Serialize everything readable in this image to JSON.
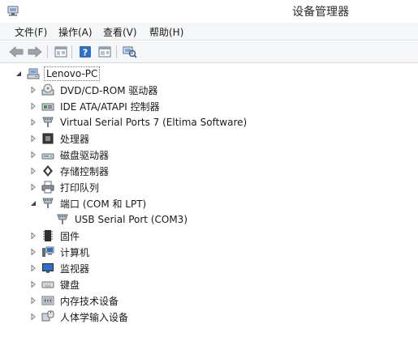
{
  "window": {
    "title": "设备管理器"
  },
  "menu": [
    {
      "label": "文件(F)"
    },
    {
      "label": "操作(A)"
    },
    {
      "label": "查看(V)"
    },
    {
      "label": "帮助(H)"
    }
  ],
  "toolbar": {
    "buttons": [
      {
        "icon": "back-arrow-icon"
      },
      {
        "icon": "forward-arrow-icon"
      },
      {
        "icon": "properties-window-icon"
      },
      {
        "icon": "help-icon"
      },
      {
        "icon": "details-window-icon"
      },
      {
        "icon": "scan-hardware-icon"
      }
    ]
  },
  "tree": {
    "root": {
      "label": "Lenovo-PC",
      "expanded": true
    },
    "items": [
      {
        "label": "DVD/CD-ROM 驱动器",
        "icon": "dvd-drive-icon",
        "expanded": false
      },
      {
        "label": "IDE ATA/ATAPI 控制器",
        "icon": "ide-controller-icon",
        "expanded": false
      },
      {
        "label": "Virtual Serial Ports 7 (Eltima Software)",
        "icon": "serial-port-icon",
        "expanded": false
      },
      {
        "label": "处理器",
        "icon": "processor-icon",
        "expanded": false
      },
      {
        "label": "磁盘驱动器",
        "icon": "disk-drive-icon",
        "expanded": false
      },
      {
        "label": "存储控制器",
        "icon": "storage-controller-icon",
        "expanded": false
      },
      {
        "label": "打印队列",
        "icon": "printer-icon",
        "expanded": false
      },
      {
        "label": "端口 (COM 和 LPT)",
        "icon": "port-icon",
        "expanded": true,
        "children": [
          {
            "label": "USB Serial Port (COM3)",
            "icon": "usb-serial-port-icon"
          }
        ]
      },
      {
        "label": "固件",
        "icon": "firmware-icon",
        "expanded": false
      },
      {
        "label": "计算机",
        "icon": "computer-icon",
        "expanded": false
      },
      {
        "label": "监视器",
        "icon": "monitor-icon",
        "expanded": false
      },
      {
        "label": "键盘",
        "icon": "keyboard-icon",
        "expanded": false
      },
      {
        "label": "内存技术设备",
        "icon": "memory-device-icon",
        "expanded": false
      },
      {
        "label": "人体学输入设备",
        "icon": "hid-icon",
        "expanded": false
      }
    ]
  }
}
